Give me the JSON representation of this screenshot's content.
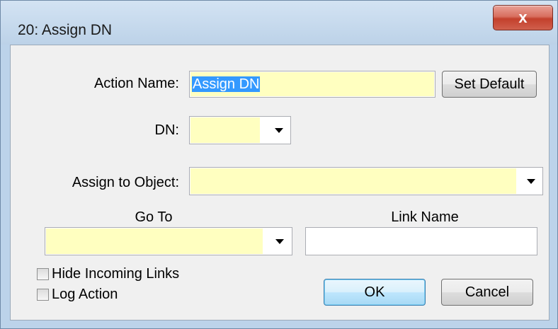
{
  "window": {
    "title": "20: Assign DN",
    "close_glyph": "x"
  },
  "form": {
    "action_name_label": "Action Name:",
    "action_name_value": "Assign DN",
    "set_default_label": "Set Default",
    "dn_label": "DN:",
    "dn_value": "",
    "assign_to_object_label": "Assign to Object:",
    "assign_to_object_value": "",
    "go_to_label": "Go To",
    "go_to_value": "",
    "link_name_label": "Link Name",
    "link_name_value": "",
    "hide_incoming_links_label": "Hide Incoming Links",
    "hide_incoming_links_checked": false,
    "log_action_label": "Log Action",
    "log_action_checked": false,
    "ok_label": "OK",
    "cancel_label": "Cancel"
  },
  "colors": {
    "field_highlight": "#ffffc0",
    "selection": "#3399ff",
    "close_button": "#c3402c",
    "default_button_border": "#3c7fb1"
  },
  "icons": [
    "close-icon",
    "dropdown-arrow-icon"
  ]
}
